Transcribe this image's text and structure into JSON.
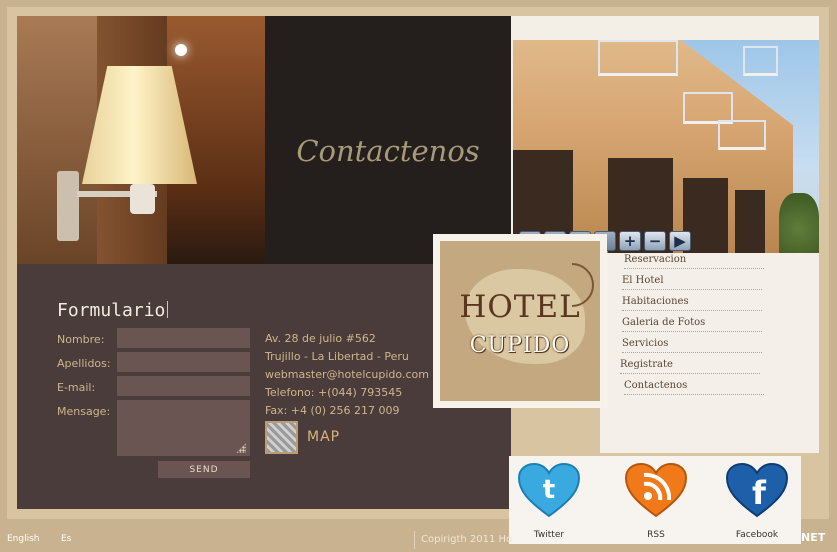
{
  "header": {
    "title": "Contactenos"
  },
  "form": {
    "title": "Formulario",
    "labels": {
      "nombre": "Nombre:",
      "apellidos": "Apellidos:",
      "email": "E-mail:",
      "mensage": "Mensage:"
    },
    "values": {
      "nombre": "",
      "apellidos": "",
      "email": "",
      "mensage": ""
    },
    "send_label": "SEND"
  },
  "contact": {
    "address": "Av. 28 de julio #562",
    "city": "Trujillo - La Libertad - Peru",
    "email": "webmaster@hotelcupido.com",
    "phone": "Telefono: +(044) 793545",
    "fax": "Fax: +4 (0) 256 217 009",
    "map_label": "MAP"
  },
  "gallery_controls": {
    "zoom_in": "+",
    "zoom_out": "−",
    "next": "▶"
  },
  "logo": {
    "line1": "HOTEL",
    "line2": "CUPIDO"
  },
  "menu": {
    "items": [
      "Reservacion",
      "El Hotel",
      "Habitaciones",
      "Galeria de Fotos",
      "Servicios",
      "Registrate",
      "Contactenos"
    ]
  },
  "social": {
    "items": [
      {
        "label": "Twitter",
        "icon": "twitter-heart-icon",
        "color": "#3aa9e0"
      },
      {
        "label": "RSS",
        "icon": "rss-heart-icon",
        "color": "#f07a1a"
      },
      {
        "label": "Facebook",
        "icon": "facebook-heart-icon",
        "color": "#1d5fa8"
      }
    ]
  },
  "footer": {
    "lang_en": "English",
    "lang_es": "Es",
    "copyright": "Copirigth 2011 Ho",
    "net": "NET"
  },
  "colors": {
    "accent": "#cfb58c",
    "panel": "#4a3c3a",
    "background": "#c8b28f"
  }
}
